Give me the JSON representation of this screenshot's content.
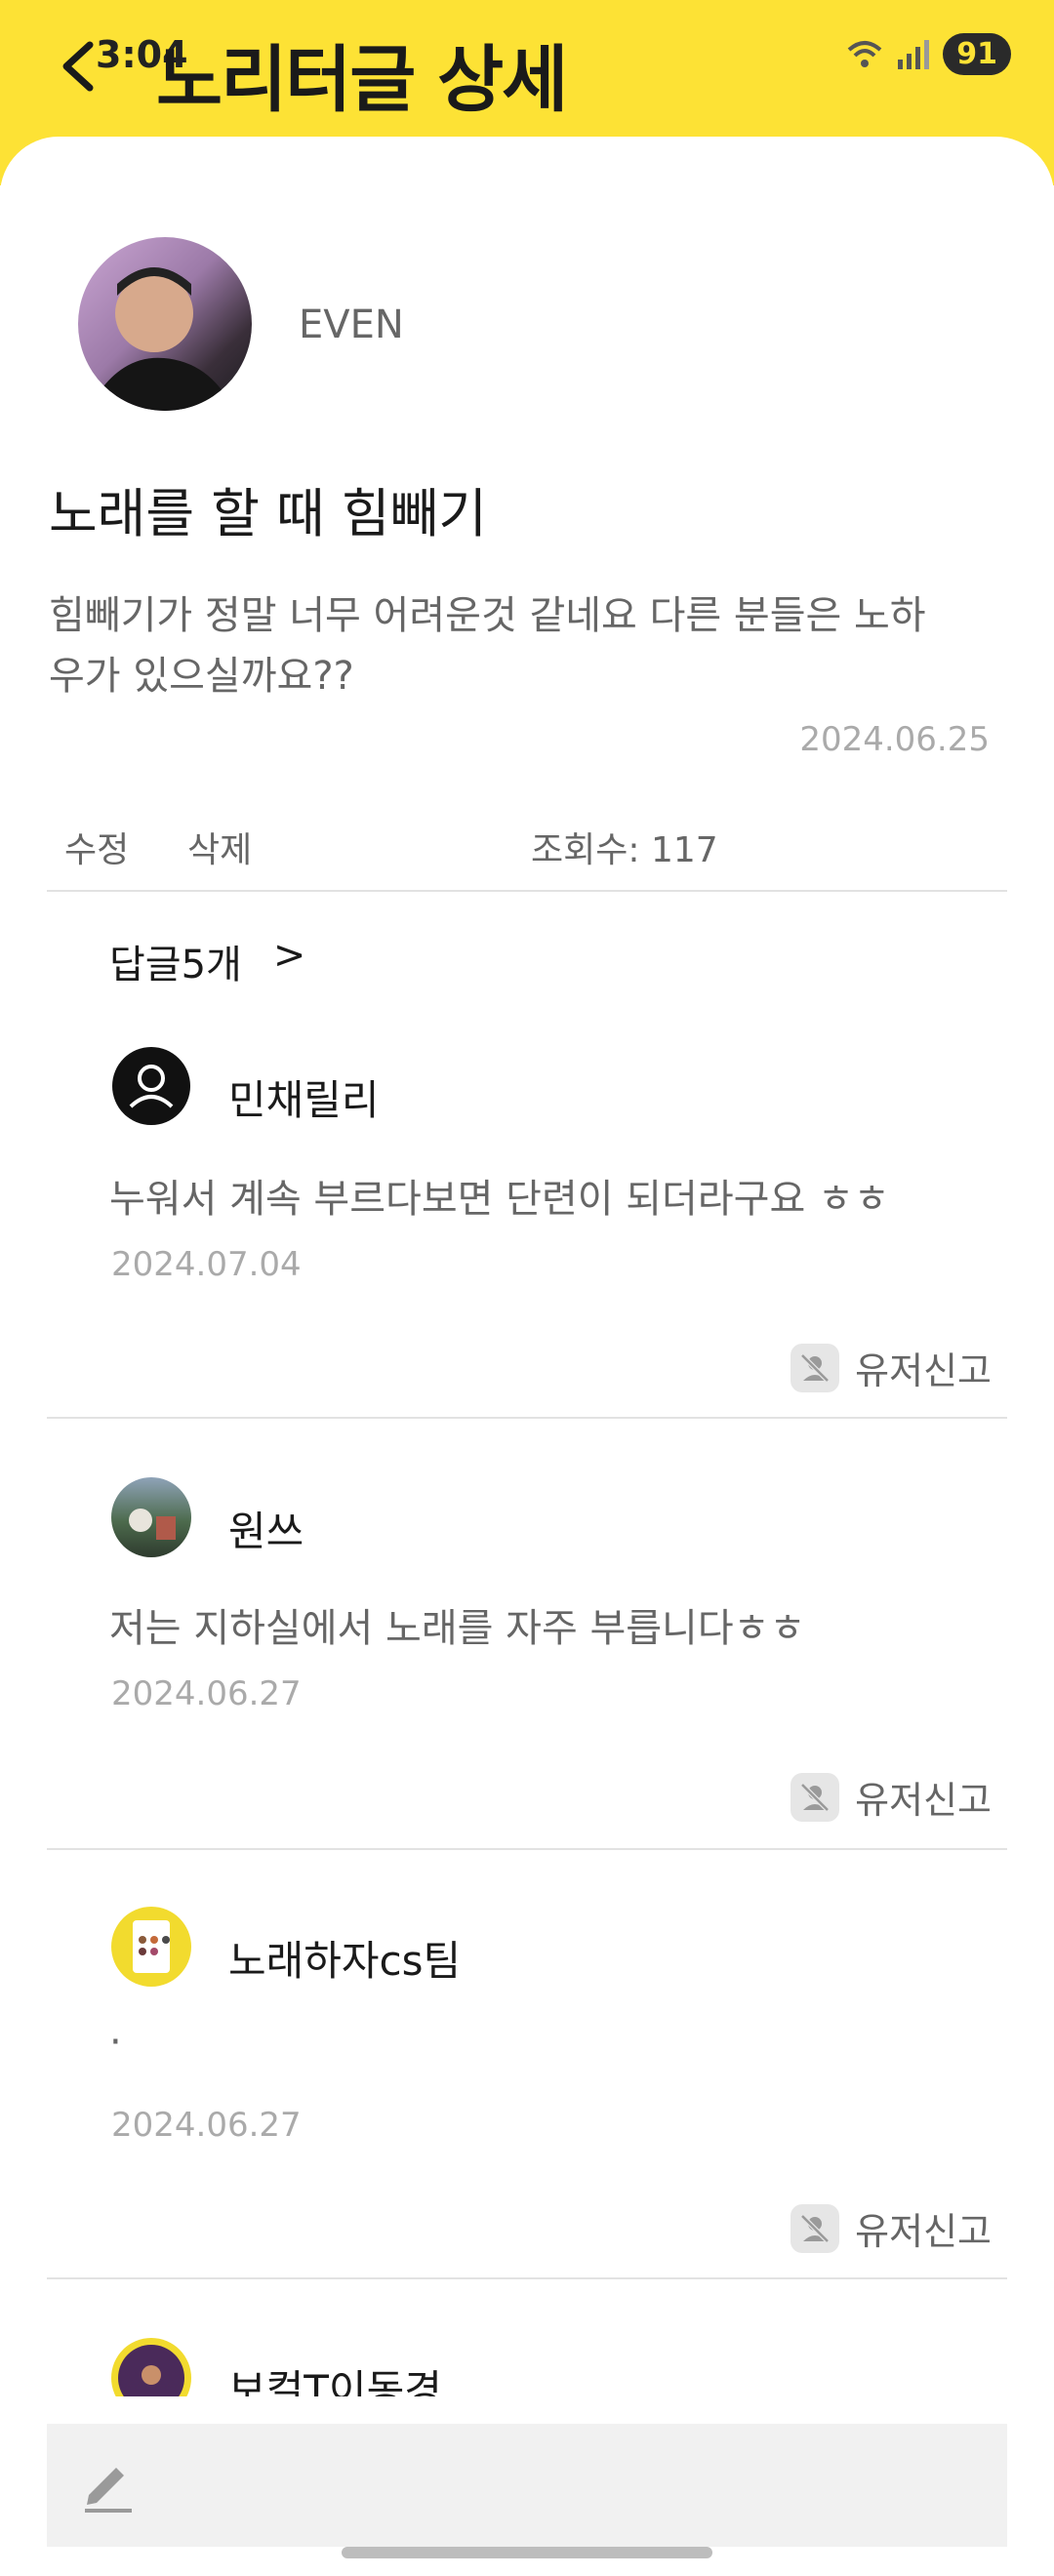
{
  "status_bar": {
    "time": "3:04",
    "battery": "91"
  },
  "header": {
    "title": "노리터글 상세"
  },
  "post": {
    "author": "EVEN",
    "title": "노래를 할 때 힘빼기",
    "body": "힘빼기가 정말 너무 어려운것 같네요 다른 분들은 노하우가 있으실까요??",
    "date": "2024.06.25",
    "edit_label": "수정",
    "delete_label": "삭제",
    "views_label": "조회수:",
    "views_count": "117"
  },
  "replies": {
    "count_label": "답글5개",
    "arrow": ">",
    "report_label": "유저신고",
    "items": [
      {
        "author": "민채릴리",
        "text": "누워서 계속 부르다보면 단련이 되더라구요 ㅎㅎ",
        "date": "2024.07.04"
      },
      {
        "author": "원쓰",
        "text": "저는 지하실에서 노래를 자주 부릅니다ㅎㅎ",
        "date": "2024.06.27"
      },
      {
        "author": "노래하자cs팀",
        "text": "·",
        "date": "2024.06.27"
      },
      {
        "author": "보컬T이동경",
        "text": "",
        "date": ""
      }
    ]
  },
  "colors": {
    "accent": "#FDE235",
    "muted_text": "#666666",
    "date_text": "#aaaaaa"
  },
  "icons": [
    "back-arrow-icon",
    "wifi-icon",
    "signal-icon",
    "user-icon",
    "report-user-icon",
    "pencil-icon"
  ]
}
